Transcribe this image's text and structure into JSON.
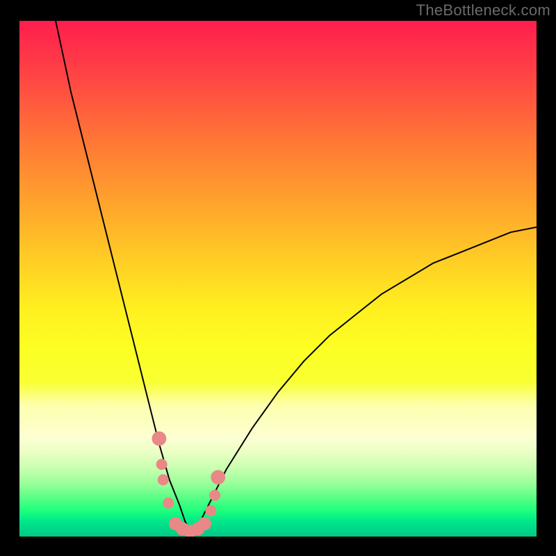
{
  "watermark": "TheBottleneck.com",
  "chart_data": {
    "type": "line",
    "title": "",
    "xlabel": "",
    "ylabel": "",
    "xlim": [
      0,
      100
    ],
    "ylim": [
      0,
      100
    ],
    "grid": false,
    "curve_note": "V-shaped bottleneck curve; minimum (~0%) at x≈33; left branch steeper than right branch which rises asymptotically toward ~60–65%.",
    "series": [
      {
        "name": "bottleneck-curve",
        "x": [
          7,
          10,
          14,
          18,
          22,
          25,
          27,
          29,
          31,
          32,
          33,
          34,
          35,
          37,
          40,
          45,
          50,
          55,
          60,
          65,
          70,
          75,
          80,
          85,
          90,
          95,
          100
        ],
        "values": [
          100,
          86,
          70,
          54,
          38,
          26,
          18,
          11,
          6,
          3,
          1,
          1,
          3,
          7,
          13,
          21,
          28,
          34,
          39,
          43,
          47,
          50,
          53,
          55,
          57,
          59,
          60
        ]
      }
    ],
    "markers": {
      "name": "highlighted-points",
      "note": "Salmon dots clustered near the curve minimum.",
      "points": [
        {
          "x": 27.0,
          "y": 19.0,
          "r": 1.3
        },
        {
          "x": 27.5,
          "y": 14.0,
          "r": 1.0
        },
        {
          "x": 27.8,
          "y": 11.0,
          "r": 1.0
        },
        {
          "x": 28.8,
          "y": 6.5,
          "r": 1.0
        },
        {
          "x": 30.2,
          "y": 2.5,
          "r": 1.2
        },
        {
          "x": 31.5,
          "y": 1.5,
          "r": 1.2
        },
        {
          "x": 33.0,
          "y": 1.0,
          "r": 1.2
        },
        {
          "x": 34.5,
          "y": 1.5,
          "r": 1.2
        },
        {
          "x": 35.8,
          "y": 2.5,
          "r": 1.2
        },
        {
          "x": 37.0,
          "y": 5.0,
          "r": 1.0
        },
        {
          "x": 37.8,
          "y": 8.0,
          "r": 1.0
        },
        {
          "x": 38.4,
          "y": 11.5,
          "r": 1.3
        }
      ]
    },
    "background": {
      "type": "vertical-gradient",
      "stops": [
        {
          "pct": 0,
          "color": "#ff1e4e"
        },
        {
          "pct": 50,
          "color": "#ffd324"
        },
        {
          "pct": 78,
          "color": "#fcffc0"
        },
        {
          "pct": 100,
          "color": "#00c985"
        }
      ]
    }
  }
}
